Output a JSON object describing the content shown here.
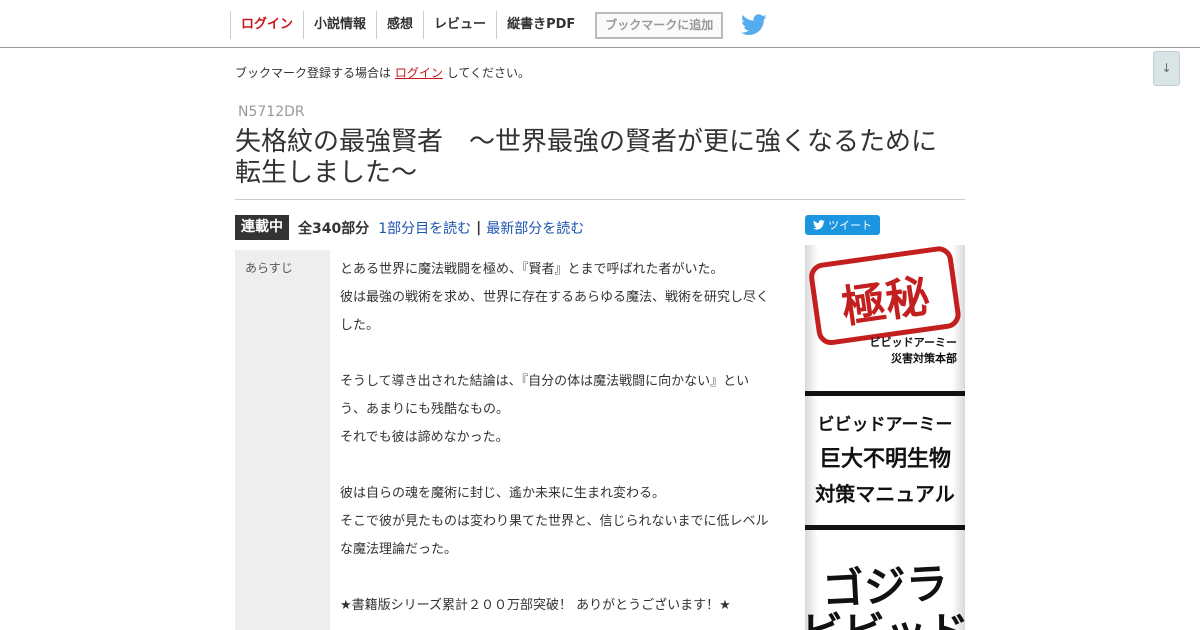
{
  "nav": {
    "login": "ログイン",
    "novel_info": "小説情報",
    "impressions": "感想",
    "review": "レビュー",
    "vertical_pdf": "縦書きPDF",
    "bookmark_add": "ブックマークに追加",
    "twitter_icon": "twitter-bird-icon"
  },
  "scroll_button": "↓",
  "bookmark_notice": {
    "before": "ブックマーク登録する場合は",
    "link": "ログイン",
    "after": "してください。"
  },
  "ncode": "N5712DR",
  "title": "失格紋の最強賢者　～世界最強の賢者が更に強くなるために転生しました～",
  "info": {
    "status": "連載中",
    "count": "全340部分",
    "read_first": "1部分目を読む",
    "separator": "|",
    "read_latest": "最新部分を読む"
  },
  "summary": {
    "label": "あらすじ",
    "text": "とある世界に魔法戦闘を極め、『賢者』とまで呼ばれた者がいた。\n彼は最強の戦術を求め、世界に存在するあらゆる魔法、戦術を研究し尽くした。\n\nそうして導き出された結論は、『自分の体は魔法戦闘に向かない』という、あまりにも残酷なもの。\nそれでも彼は諦めなかった。\n\n彼は自らの魂を魔術に封じ、遙か未来に生まれ変わる。\nそこで彼が見たものは変わり果てた世界と、信じられないまでに低レベルな魔法理論だった。\n\n★書籍版シリーズ累計２００万部突破！ ありがとうございます！★"
  },
  "tweet_button": "ツイート",
  "ad": {
    "stamp_text": "極秘",
    "stamp_sub1": "ビビッドアーミー",
    "stamp_sub2": "災害対策本部",
    "line1": "ビビッドアーミー",
    "line2": "巨大不明生物",
    "line3": "対策マニュアル",
    "line4": "ゴジラ",
    "line5": "ビビッド"
  },
  "colors": {
    "accent_red": "#c8161d",
    "link_blue": "#1c53b0",
    "twitter_blue": "#1b95e0"
  }
}
